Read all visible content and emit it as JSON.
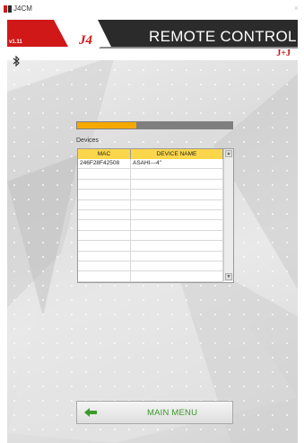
{
  "window": {
    "title": "J4CM",
    "close_glyph": "×"
  },
  "header": {
    "version": "v1.11",
    "title": "REMOTE CONTROL",
    "logo_text": "J4",
    "brand_text": "J+J",
    "bluetooth_icon": "bluetooth-icon"
  },
  "progress": {
    "fraction": 0.38,
    "color": "#f5a800"
  },
  "devices": {
    "label": "Devices",
    "columns": [
      "MAC",
      "DEVICE NAME"
    ],
    "rows": [
      [
        "246F28F42508",
        "ASAHI---4\""
      ],
      [
        "",
        ""
      ],
      [
        "",
        ""
      ],
      [
        "",
        ""
      ],
      [
        "",
        ""
      ],
      [
        "",
        ""
      ],
      [
        "",
        ""
      ],
      [
        "",
        ""
      ],
      [
        "",
        ""
      ],
      [
        "",
        ""
      ],
      [
        "",
        ""
      ],
      [
        "",
        ""
      ]
    ],
    "scroll_up": "▲",
    "scroll_down": "▼"
  },
  "main_menu": {
    "label": "MAIN MENU",
    "icon": "back-arrow-icon"
  },
  "colors": {
    "header_dark": "#2b2b2b",
    "accent_red": "#d01818",
    "menu_green": "#3a9a2a"
  }
}
